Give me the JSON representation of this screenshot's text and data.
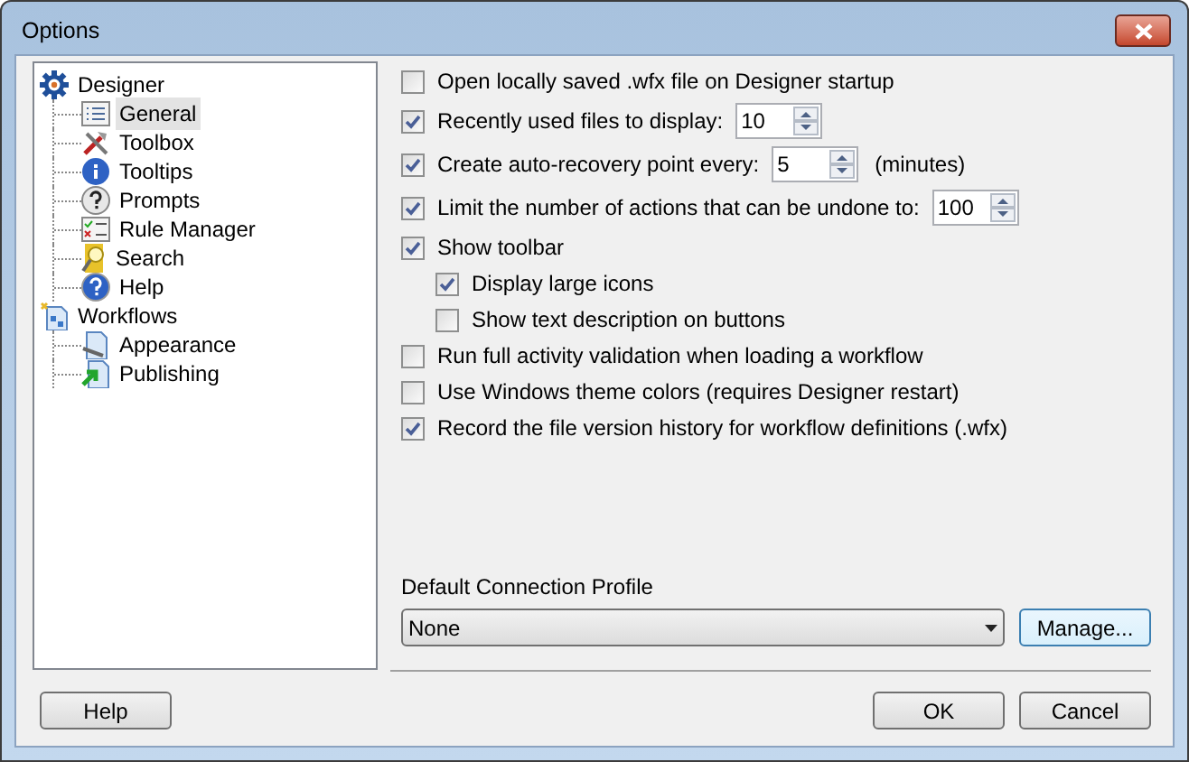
{
  "window": {
    "title": "Options"
  },
  "tree": [
    {
      "label": "Designer",
      "selected": false,
      "children": [
        {
          "label": "General",
          "selected": true
        },
        {
          "label": "Toolbox",
          "selected": false
        },
        {
          "label": "Tooltips",
          "selected": false
        },
        {
          "label": "Prompts",
          "selected": false
        },
        {
          "label": "Rule Manager",
          "selected": false
        },
        {
          "label": "Search",
          "selected": false
        },
        {
          "label": "Help",
          "selected": false
        }
      ]
    },
    {
      "label": "Workflows",
      "selected": false,
      "children": [
        {
          "label": "Appearance",
          "selected": false
        },
        {
          "label": "Publishing",
          "selected": false
        }
      ]
    }
  ],
  "options": [
    {
      "kind": "check",
      "label": "Open locally saved .wfx file on Designer startup",
      "checked": false
    },
    {
      "kind": "spin",
      "label": "Recently used files to display:",
      "checked": true,
      "value": "10"
    },
    {
      "kind": "spin",
      "label": "Create auto-recovery point every:",
      "checked": true,
      "value": "5",
      "suffix": "(minutes)"
    },
    {
      "kind": "spin",
      "label": "Limit the number of actions that can be undone to:",
      "checked": true,
      "value": "100"
    },
    {
      "kind": "check",
      "label": "Show toolbar",
      "checked": true,
      "children": [
        {
          "kind": "check",
          "label": "Display large icons",
          "checked": true
        },
        {
          "kind": "check",
          "label": "Show text description on buttons",
          "checked": false
        }
      ]
    },
    {
      "kind": "check",
      "label": "Run full activity validation when loading a workflow",
      "checked": false
    },
    {
      "kind": "check",
      "label": "Use Windows theme colors (requires Designer restart)",
      "checked": false
    },
    {
      "kind": "check",
      "label": "Record the file version history for workflow definitions (.wfx)",
      "checked": true
    }
  ],
  "connection_profile": {
    "label": "Default Connection Profile",
    "value": "None",
    "button": "Manage..."
  },
  "buttons": {
    "help": "Help",
    "ok": "OK",
    "cancel": "Cancel"
  }
}
